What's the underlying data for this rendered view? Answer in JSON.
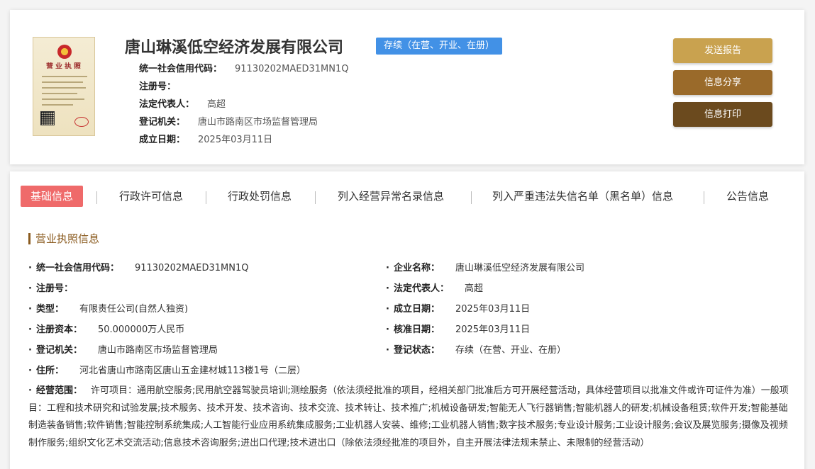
{
  "header": {
    "company_name": "唐山琳溪低空经济发展有限公司",
    "status_badge": "存续（在营、开业、在册）",
    "info": [
      {
        "label": "统一社会信用代码：",
        "value": "91130202MAED31MN1Q"
      },
      {
        "label": "注册号：",
        "value": ""
      },
      {
        "label": "法定代表人：",
        "value": "高超"
      },
      {
        "label": "登记机关：",
        "value": "唐山市路南区市场监督管理局"
      },
      {
        "label": "成立日期：",
        "value": "2025年03月11日"
      }
    ],
    "license_image_text": "营业执照"
  },
  "actions": {
    "send_report": "发送报告",
    "share": "信息分享",
    "print": "信息打印"
  },
  "tabs": [
    "基础信息",
    "行政许可信息",
    "行政处罚信息",
    "列入经营异常名录信息",
    "列入严重违法失信名单（黑名单）信息",
    "公告信息"
  ],
  "section": {
    "title": "营业执照信息",
    "left_fields": [
      {
        "label": "统一社会信用代码：",
        "value": "91130202MAED31MN1Q"
      },
      {
        "label": "注册号：",
        "value": ""
      },
      {
        "label": "类型：",
        "value": "有限责任公司(自然人独资)"
      },
      {
        "label": "注册资本：",
        "value": "50.000000万人民币"
      },
      {
        "label": "登记机关：",
        "value": "唐山市路南区市场监督管理局"
      },
      {
        "label": "住所：",
        "value": "河北省唐山市路南区唐山五金建材城113楼1号（二层）"
      }
    ],
    "right_fields": [
      {
        "label": "企业名称：",
        "value": "唐山琳溪低空经济发展有限公司"
      },
      {
        "label": "法定代表人：",
        "value": "高超"
      },
      {
        "label": "成立日期：",
        "value": "2025年03月11日"
      },
      {
        "label": "核准日期：",
        "value": "2025年03月11日"
      },
      {
        "label": "登记状态：",
        "value": "存续（在营、开业、在册）"
      }
    ],
    "scope_label": "经营范围：",
    "scope_value": "许可项目：通用航空服务;民用航空器驾驶员培训;测绘服务（依法须经批准的项目，经相关部门批准后方可开展经营活动，具体经营项目以批准文件或许可证件为准）一般项目：工程和技术研究和试验发展;技术服务、技术开发、技术咨询、技术交流、技术转让、技术推广;机械设备研发;智能无人飞行器销售;智能机器人的研发;机械设备租赁;软件开发;智能基础制造装备销售;软件销售;智能控制系统集成;人工智能行业应用系统集成服务;工业机器人安装、维修;工业机器人销售;数字技术服务;专业设计服务;工业设计服务;会议及展览服务;摄像及视频制作服务;组织文化艺术交流活动;信息技术咨询服务;进出口代理;技术进出口（除依法须经批准的项目外，自主开展法律法规未禁止、未限制的经营活动）"
  },
  "colors": {
    "badge": "#4291e6",
    "send_report": "#c9a24f",
    "share": "#9a6a2a",
    "print": "#6b4a1e",
    "active_tab": "#ef6a6a",
    "section_accent": "#8a5a1e"
  }
}
